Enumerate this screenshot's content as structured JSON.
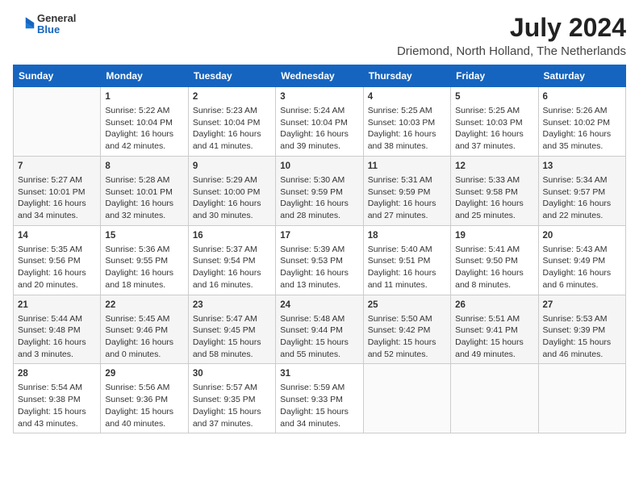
{
  "logo": {
    "general": "General",
    "blue": "Blue"
  },
  "title": "July 2024",
  "location": "Driemond, North Holland, The Netherlands",
  "days_of_week": [
    "Sunday",
    "Monday",
    "Tuesday",
    "Wednesday",
    "Thursday",
    "Friday",
    "Saturday"
  ],
  "weeks": [
    [
      {
        "day": "",
        "info": ""
      },
      {
        "day": "1",
        "info": "Sunrise: 5:22 AM\nSunset: 10:04 PM\nDaylight: 16 hours\nand 42 minutes."
      },
      {
        "day": "2",
        "info": "Sunrise: 5:23 AM\nSunset: 10:04 PM\nDaylight: 16 hours\nand 41 minutes."
      },
      {
        "day": "3",
        "info": "Sunrise: 5:24 AM\nSunset: 10:04 PM\nDaylight: 16 hours\nand 39 minutes."
      },
      {
        "day": "4",
        "info": "Sunrise: 5:25 AM\nSunset: 10:03 PM\nDaylight: 16 hours\nand 38 minutes."
      },
      {
        "day": "5",
        "info": "Sunrise: 5:25 AM\nSunset: 10:03 PM\nDaylight: 16 hours\nand 37 minutes."
      },
      {
        "day": "6",
        "info": "Sunrise: 5:26 AM\nSunset: 10:02 PM\nDaylight: 16 hours\nand 35 minutes."
      }
    ],
    [
      {
        "day": "7",
        "info": "Sunrise: 5:27 AM\nSunset: 10:01 PM\nDaylight: 16 hours\nand 34 minutes."
      },
      {
        "day": "8",
        "info": "Sunrise: 5:28 AM\nSunset: 10:01 PM\nDaylight: 16 hours\nand 32 minutes."
      },
      {
        "day": "9",
        "info": "Sunrise: 5:29 AM\nSunset: 10:00 PM\nDaylight: 16 hours\nand 30 minutes."
      },
      {
        "day": "10",
        "info": "Sunrise: 5:30 AM\nSunset: 9:59 PM\nDaylight: 16 hours\nand 28 minutes."
      },
      {
        "day": "11",
        "info": "Sunrise: 5:31 AM\nSunset: 9:59 PM\nDaylight: 16 hours\nand 27 minutes."
      },
      {
        "day": "12",
        "info": "Sunrise: 5:33 AM\nSunset: 9:58 PM\nDaylight: 16 hours\nand 25 minutes."
      },
      {
        "day": "13",
        "info": "Sunrise: 5:34 AM\nSunset: 9:57 PM\nDaylight: 16 hours\nand 22 minutes."
      }
    ],
    [
      {
        "day": "14",
        "info": "Sunrise: 5:35 AM\nSunset: 9:56 PM\nDaylight: 16 hours\nand 20 minutes."
      },
      {
        "day": "15",
        "info": "Sunrise: 5:36 AM\nSunset: 9:55 PM\nDaylight: 16 hours\nand 18 minutes."
      },
      {
        "day": "16",
        "info": "Sunrise: 5:37 AM\nSunset: 9:54 PM\nDaylight: 16 hours\nand 16 minutes."
      },
      {
        "day": "17",
        "info": "Sunrise: 5:39 AM\nSunset: 9:53 PM\nDaylight: 16 hours\nand 13 minutes."
      },
      {
        "day": "18",
        "info": "Sunrise: 5:40 AM\nSunset: 9:51 PM\nDaylight: 16 hours\nand 11 minutes."
      },
      {
        "day": "19",
        "info": "Sunrise: 5:41 AM\nSunset: 9:50 PM\nDaylight: 16 hours\nand 8 minutes."
      },
      {
        "day": "20",
        "info": "Sunrise: 5:43 AM\nSunset: 9:49 PM\nDaylight: 16 hours\nand 6 minutes."
      }
    ],
    [
      {
        "day": "21",
        "info": "Sunrise: 5:44 AM\nSunset: 9:48 PM\nDaylight: 16 hours\nand 3 minutes."
      },
      {
        "day": "22",
        "info": "Sunrise: 5:45 AM\nSunset: 9:46 PM\nDaylight: 16 hours\nand 0 minutes."
      },
      {
        "day": "23",
        "info": "Sunrise: 5:47 AM\nSunset: 9:45 PM\nDaylight: 15 hours\nand 58 minutes."
      },
      {
        "day": "24",
        "info": "Sunrise: 5:48 AM\nSunset: 9:44 PM\nDaylight: 15 hours\nand 55 minutes."
      },
      {
        "day": "25",
        "info": "Sunrise: 5:50 AM\nSunset: 9:42 PM\nDaylight: 15 hours\nand 52 minutes."
      },
      {
        "day": "26",
        "info": "Sunrise: 5:51 AM\nSunset: 9:41 PM\nDaylight: 15 hours\nand 49 minutes."
      },
      {
        "day": "27",
        "info": "Sunrise: 5:53 AM\nSunset: 9:39 PM\nDaylight: 15 hours\nand 46 minutes."
      }
    ],
    [
      {
        "day": "28",
        "info": "Sunrise: 5:54 AM\nSunset: 9:38 PM\nDaylight: 15 hours\nand 43 minutes."
      },
      {
        "day": "29",
        "info": "Sunrise: 5:56 AM\nSunset: 9:36 PM\nDaylight: 15 hours\nand 40 minutes."
      },
      {
        "day": "30",
        "info": "Sunrise: 5:57 AM\nSunset: 9:35 PM\nDaylight: 15 hours\nand 37 minutes."
      },
      {
        "day": "31",
        "info": "Sunrise: 5:59 AM\nSunset: 9:33 PM\nDaylight: 15 hours\nand 34 minutes."
      },
      {
        "day": "",
        "info": ""
      },
      {
        "day": "",
        "info": ""
      },
      {
        "day": "",
        "info": ""
      }
    ]
  ]
}
